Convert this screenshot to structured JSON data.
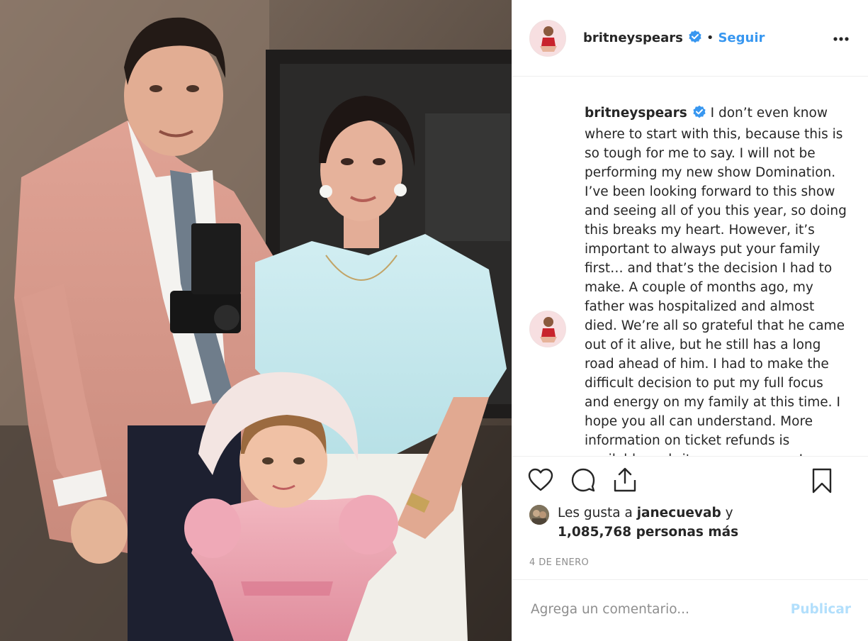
{
  "post": {
    "user": {
      "username": "britneyspears",
      "verified_icon": "verified-badge-icon",
      "separator": "•",
      "follow_label": "Seguir"
    },
    "caption": {
      "username": "britneyspears",
      "text": "I don’t even know where to start with this, because this is so tough for me to say. I will not be performing my new show Domination. I’ve been looking forward to this show and seeing all of you this year, so doing this breaks my heart. However, it’s important to always put your family first… and that’s the decision I had to make. A couple of months ago, my father was hospitalized and almost died. We’re all so grateful that he came out of it alive, but he still has a long road ahead of him. I had to make the difficult decision to put my full focus and energy on my family at this time. I hope you all can understand. More information on ticket refunds is available on britneyspears.com. I"
    },
    "actions": {
      "icons": [
        "heart-icon",
        "comment-icon",
        "share-icon",
        "bookmark-icon"
      ]
    },
    "likes": {
      "prefix": "Les gusta a",
      "user": "janecuevab",
      "conjunction": "y",
      "others": "1,085,768 personas más"
    },
    "date": "4 DE ENERO",
    "comment_box": {
      "placeholder": "Agrega un comentario...",
      "value": "",
      "publish_label": "Publicar"
    },
    "colors": {
      "link": "#3897f0",
      "publish_disabled": "#b2dffc",
      "muted": "#8e8e8e",
      "text": "#262626"
    }
  }
}
